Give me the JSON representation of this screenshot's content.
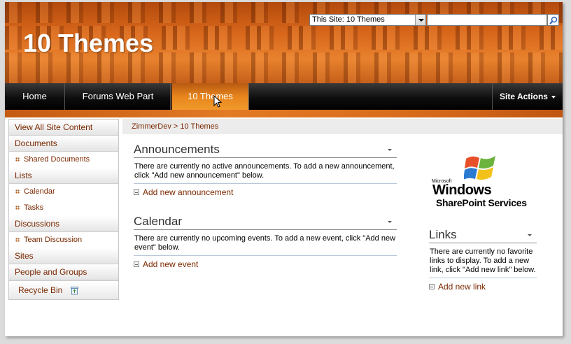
{
  "site": {
    "title": "10 Themes"
  },
  "search": {
    "scope": "This Site: 10 Themes",
    "query": ""
  },
  "topnav": {
    "items": [
      {
        "label": "Home"
      },
      {
        "label": "Forums Web Part"
      },
      {
        "label": "10 Themes"
      }
    ],
    "active": "10 Themes",
    "site_actions": "Site Actions"
  },
  "quicklaunch": {
    "view_all": "View All Site Content",
    "documents": "Documents",
    "shared_documents": "Shared Documents",
    "lists": "Lists",
    "calendar": "Calendar",
    "tasks": "Tasks",
    "discussions": "Discussions",
    "team_discussion": "Team Discussion",
    "sites": "Sites",
    "people_groups": "People and Groups",
    "recycle_bin": "Recycle Bin"
  },
  "breadcrumb": {
    "root": "ZimmerDev",
    "separator": ">",
    "current": "10 Themes"
  },
  "announcements": {
    "title": "Announcements",
    "body": "There are currently no active announcements. To add a new announcement, click \"Add new announcement\" below.",
    "add": "Add new announcement"
  },
  "calendar": {
    "title": "Calendar",
    "body": "There are currently no upcoming events. To add a new event, click \"Add new event\" below.",
    "add": "Add new event"
  },
  "links": {
    "title": "Links",
    "body": "There are currently no favorite links to display. To add a new link, click \"Add new link\" below.",
    "add": "Add new link"
  },
  "logo": {
    "microsoft": "Microsoft",
    "windows": "Windows",
    "sharepoint": "SharePoint Services"
  },
  "colors": {
    "accent": "#e8851d",
    "link": "#7a2800",
    "nav_bg": "#0e0e0e"
  }
}
